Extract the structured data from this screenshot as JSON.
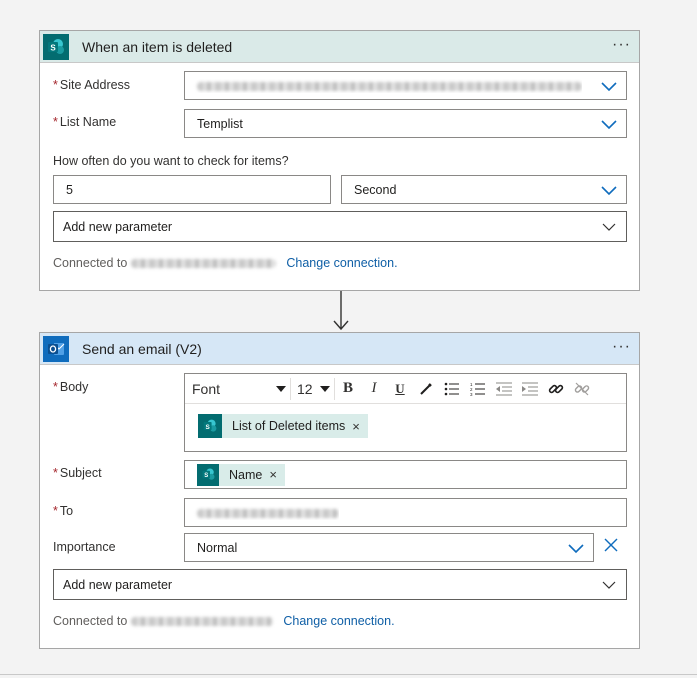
{
  "trigger": {
    "title": "When an item is deleted",
    "menu": "···",
    "site_address_label": "Site Address",
    "list_name_label": "List Name",
    "list_name_value": "Templist",
    "frequency_label": "How often do you want to check for items?",
    "interval_value": "5",
    "frequency_value": "Second",
    "add_param": "Add new parameter",
    "connected_to": "Connected to",
    "change_connection": "Change connection."
  },
  "action": {
    "title": "Send an email (V2)",
    "menu": "···",
    "body_label": "Body",
    "font_name": "Font",
    "font_size": "12",
    "bold": "B",
    "italic": "I",
    "underline": "U",
    "body_token": "List of Deleted items",
    "subject_label": "Subject",
    "subject_token": "Name",
    "to_label": "To",
    "importance_label": "Importance",
    "importance_value": "Normal",
    "add_param": "Add new parameter",
    "connected_to": "Connected to",
    "change_connection": "Change connection."
  },
  "token_remove": "×",
  "colors": {
    "sharepoint": "#036c70",
    "outlook": "#0f6cbd",
    "link": "#0f5fa6",
    "required": "#a4262c"
  }
}
